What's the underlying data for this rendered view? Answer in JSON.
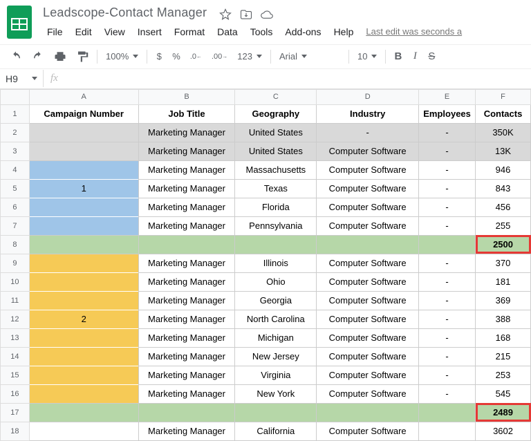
{
  "doc": {
    "title": "Leadscope-Contact Manager"
  },
  "menu": {
    "file": "File",
    "edit": "Edit",
    "view": "View",
    "insert": "Insert",
    "format": "Format",
    "data": "Data",
    "tools": "Tools",
    "addons": "Add-ons",
    "help": "Help",
    "lastedit": "Last edit was seconds a"
  },
  "toolbar": {
    "zoom": "100%",
    "dollar": "$",
    "percent": "%",
    "dec0": ".0_",
    "dec00": ".00_",
    "num": "123",
    "font": "Arial",
    "size": "10",
    "bold": "B",
    "italic": "I",
    "strike": "S"
  },
  "namebox": "H9",
  "cols": [
    "A",
    "B",
    "C",
    "D",
    "E",
    "F"
  ],
  "headers": {
    "A": "Campaign Number",
    "B": "Job Title",
    "C": "Geography",
    "D": "Industry",
    "E": "Employees",
    "F": "Contacts"
  },
  "rows": [
    {
      "n": 2,
      "bg": "grey",
      "A": "",
      "B": "Marketing Manager",
      "C": "United States",
      "D": "-",
      "E": "-",
      "F": "350K"
    },
    {
      "n": 3,
      "bg": "grey",
      "A": "",
      "B": "Marketing Manager",
      "C": "United States",
      "D": "Computer Software",
      "E": "-",
      "F": "13K"
    },
    {
      "n": 4,
      "A": "",
      "B": "Marketing Manager",
      "C": "Massachusetts",
      "D": "Computer Software",
      "E": "-",
      "F": "946"
    },
    {
      "n": 5,
      "A": "",
      "B": "Marketing Manager",
      "C": "Texas",
      "D": "Computer Software",
      "E": "-",
      "F": "843"
    },
    {
      "n": 6,
      "A": "",
      "B": "Marketing Manager",
      "C": "Florida",
      "D": "Computer Software",
      "E": "-",
      "F": "456"
    },
    {
      "n": 7,
      "A": "",
      "B": "Marketing Manager",
      "C": "Pennsylvania",
      "D": "Computer Software",
      "E": "-",
      "F": "255"
    },
    {
      "n": 8,
      "bg": "green",
      "A": "",
      "B": "",
      "C": "",
      "D": "",
      "E": "",
      "F": "2500",
      "red": true
    },
    {
      "n": 9,
      "A": "",
      "B": "Marketing Manager",
      "C": "Illinois",
      "D": "Computer Software",
      "E": "-",
      "F": "370"
    },
    {
      "n": 10,
      "A": "",
      "B": "Marketing Manager",
      "C": "Ohio",
      "D": "Computer Software",
      "E": "-",
      "F": "181"
    },
    {
      "n": 11,
      "A": "",
      "B": "Marketing Manager",
      "C": "Georgia",
      "D": "Computer Software",
      "E": "-",
      "F": "369"
    },
    {
      "n": 12,
      "A": "",
      "B": "Marketing Manager",
      "C": "North Carolina",
      "D": "Computer Software",
      "E": "-",
      "F": "388"
    },
    {
      "n": 13,
      "A": "",
      "B": "Marketing Manager",
      "C": "Michigan",
      "D": "Computer Software",
      "E": "-",
      "F": "168"
    },
    {
      "n": 14,
      "A": "",
      "B": "Marketing Manager",
      "C": "New Jersey",
      "D": "Computer Software",
      "E": "-",
      "F": "215"
    },
    {
      "n": 15,
      "A": "",
      "B": "Marketing Manager",
      "C": "Virginia",
      "D": "Computer Software",
      "E": "-",
      "F": "253"
    },
    {
      "n": 16,
      "A": "",
      "B": "Marketing Manager",
      "C": "New York",
      "D": "Computer Software",
      "E": "-",
      "F": "545"
    },
    {
      "n": 17,
      "bg": "green",
      "A": "",
      "B": "",
      "C": "",
      "D": "",
      "E": "",
      "F": "2489",
      "red": true
    },
    {
      "n": 18,
      "A": "",
      "B": "Marketing Manager",
      "C": "California",
      "D": "Computer Software",
      "E": "",
      "F": "3602"
    }
  ],
  "merges": [
    {
      "col": "A",
      "from": 4,
      "to": 7,
      "text": "1",
      "bg": "blue"
    },
    {
      "col": "A",
      "from": 9,
      "to": 16,
      "text": "2",
      "bg": "yellow"
    }
  ]
}
